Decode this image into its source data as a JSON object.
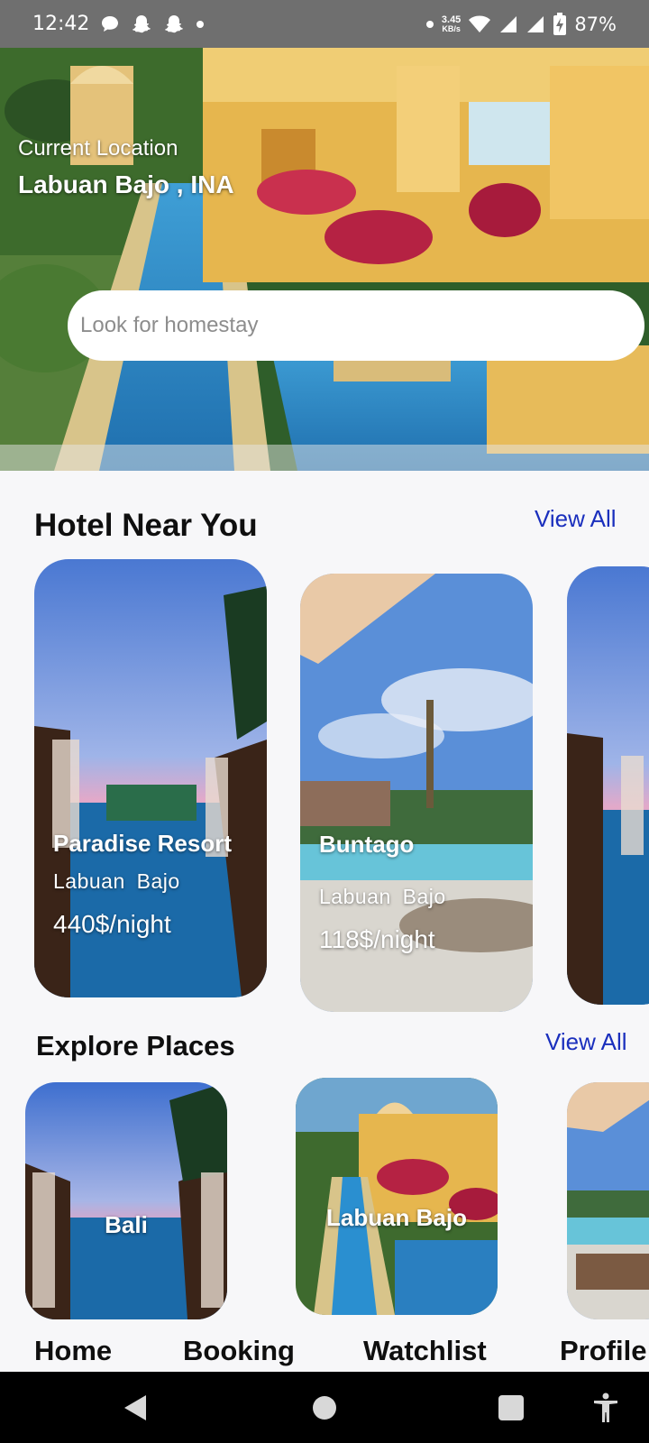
{
  "status_bar": {
    "time": "12:42",
    "speed_value": "3.45",
    "speed_unit": "KB/s",
    "battery": "87%"
  },
  "hero": {
    "location_label": "Current Location",
    "location_value": "Labuan Bajo , INA",
    "search_placeholder": "Look for homestay"
  },
  "hotels": {
    "title": "Hotel Near You",
    "view_all": "View All",
    "items": [
      {
        "name": "Paradise Resort",
        "location": "Labuan Bajo",
        "price": "440$/night"
      },
      {
        "name": "Buntago",
        "location": "Labuan Bajo",
        "price": "118$/night"
      }
    ]
  },
  "places": {
    "title": "Explore Places",
    "view_all": "View All",
    "items": [
      {
        "label": "Bali"
      },
      {
        "label": "Labuan Bajo"
      }
    ]
  },
  "tabs": [
    "Home",
    "Booking",
    "Watchlist",
    "Profile"
  ],
  "nav": [
    "back-icon",
    "home-icon",
    "recents-icon",
    "accessibility-icon"
  ]
}
